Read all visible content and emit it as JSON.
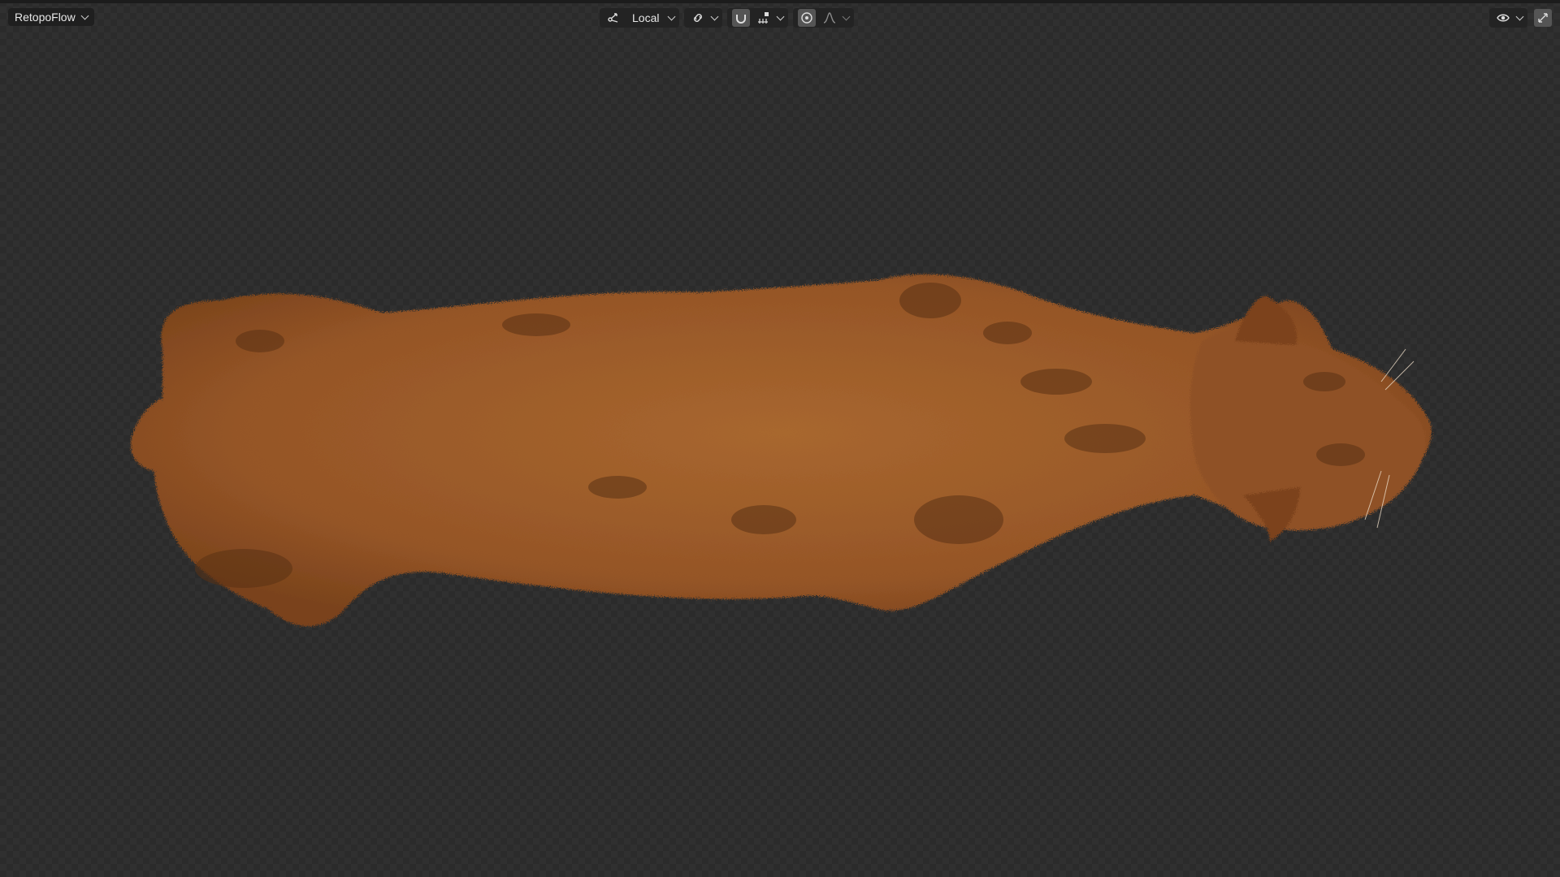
{
  "header": {
    "mode_label": "RetopoFlow",
    "pivot_label": "Local"
  },
  "icons": {
    "mode_dropdown": "chevron-down-icon",
    "transform_orientation": "transform-orientation-icon",
    "pivot_dropdown": "chevron-down-icon",
    "link": "link-icon",
    "snap_magnet": "magnet-icon",
    "snap_target": "snap-increment-icon",
    "proportional": "proportional-edit-icon",
    "falloff": "falloff-curve-icon",
    "visibility": "eye-icon",
    "gizmo": "gizmo-icon"
  },
  "colors": {
    "viewport_bg": "#2b2b2b",
    "header_bg": "#1f1f1f",
    "fur_base": "#9a5a2c",
    "fur_dark": "#5a3114"
  },
  "scene": {
    "subject": "top-down render of a fur-covered big cat"
  }
}
